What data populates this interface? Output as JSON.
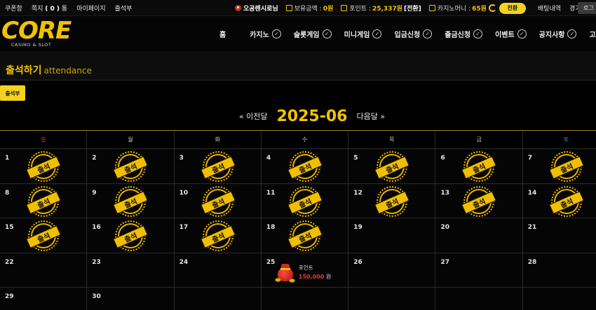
{
  "topbar": {
    "left_links": [
      "쿠폰함",
      "마이페이지",
      "출석부"
    ],
    "messages": {
      "label": "쪽지",
      "count": "( 0 )",
      "unit": "통"
    },
    "username": "오공렌시로님",
    "balance": {
      "label": "보유금액 :",
      "value": "0원"
    },
    "points": {
      "label": "포인트 :",
      "value": "25,337원",
      "suffix": "[전환]"
    },
    "casino_money": {
      "label": "카지노머니 :",
      "value": "65원"
    },
    "convert_button": "전환",
    "bet_history": "배팅내역",
    "game_results": "경기결과",
    "login_button": "로그"
  },
  "nav": {
    "logo": {
      "main": "CORE",
      "sub": "CASINO & SLOT"
    },
    "home": "홈",
    "items": [
      {
        "label": "카지노",
        "icon": "check-circle-icon"
      },
      {
        "label": "슬롯게임",
        "icon": "check-circle-icon"
      },
      {
        "label": "미니게임",
        "icon": "check-circle-icon"
      },
      {
        "label": "입금신청",
        "icon": "check-circle-icon"
      },
      {
        "label": "출금신청",
        "icon": "check-circle-icon"
      },
      {
        "label": "이벤트",
        "icon": "check-circle-icon"
      },
      {
        "label": "공지사항",
        "icon": "check-circle-icon"
      },
      {
        "label": "고객",
        "icon": "check-circle-icon"
      }
    ]
  },
  "page": {
    "title": "출석하기",
    "subtitle": "attendance",
    "tab": "출석부"
  },
  "calendar": {
    "month": "2025-06",
    "prev": "« 이전달",
    "next": "다음달 »",
    "weekdays": [
      "일",
      "월",
      "화",
      "수",
      "목",
      "금",
      "토"
    ],
    "stamp_text": "출석",
    "weeks": [
      [
        {
          "d": "1",
          "s": true
        },
        {
          "d": "2",
          "s": true
        },
        {
          "d": "3",
          "s": true
        },
        {
          "d": "4",
          "s": true
        },
        {
          "d": "5",
          "s": true
        },
        {
          "d": "6",
          "s": true
        },
        {
          "d": "7",
          "s": true
        }
      ],
      [
        {
          "d": "8",
          "s": true
        },
        {
          "d": "9",
          "s": true
        },
        {
          "d": "10",
          "s": true
        },
        {
          "d": "11",
          "s": true
        },
        {
          "d": "12",
          "s": true
        },
        {
          "d": "13",
          "s": true
        },
        {
          "d": "14",
          "s": true
        }
      ],
      [
        {
          "d": "15",
          "s": true
        },
        {
          "d": "16",
          "s": true
        },
        {
          "d": "17",
          "s": true
        },
        {
          "d": "18",
          "s": true
        },
        {
          "d": "19",
          "s": false
        },
        {
          "d": "20",
          "s": false
        },
        {
          "d": "21",
          "s": false
        }
      ],
      [
        {
          "d": "22",
          "s": false
        },
        {
          "d": "23",
          "s": false
        },
        {
          "d": "24",
          "s": false
        },
        {
          "d": "25",
          "s": false,
          "reward": true
        },
        {
          "d": "26",
          "s": false
        },
        {
          "d": "27",
          "s": false
        },
        {
          "d": "28",
          "s": false
        }
      ],
      [
        {
          "d": "29",
          "s": false
        },
        {
          "d": "30",
          "s": false
        },
        {
          "d": "",
          "s": false
        },
        {
          "d": "",
          "s": false
        },
        {
          "d": "",
          "s": false
        },
        {
          "d": "",
          "s": false
        },
        {
          "d": "",
          "s": false
        }
      ]
    ],
    "reward": {
      "label": "포인트",
      "amount": "150,000",
      "unit": "원",
      "icon": "money-bag-icon"
    }
  },
  "colors": {
    "accent": "#f2c200",
    "sunday": "#e33b2b",
    "saturday": "#3a8fe0",
    "reward_amount": "#e53a2a"
  }
}
